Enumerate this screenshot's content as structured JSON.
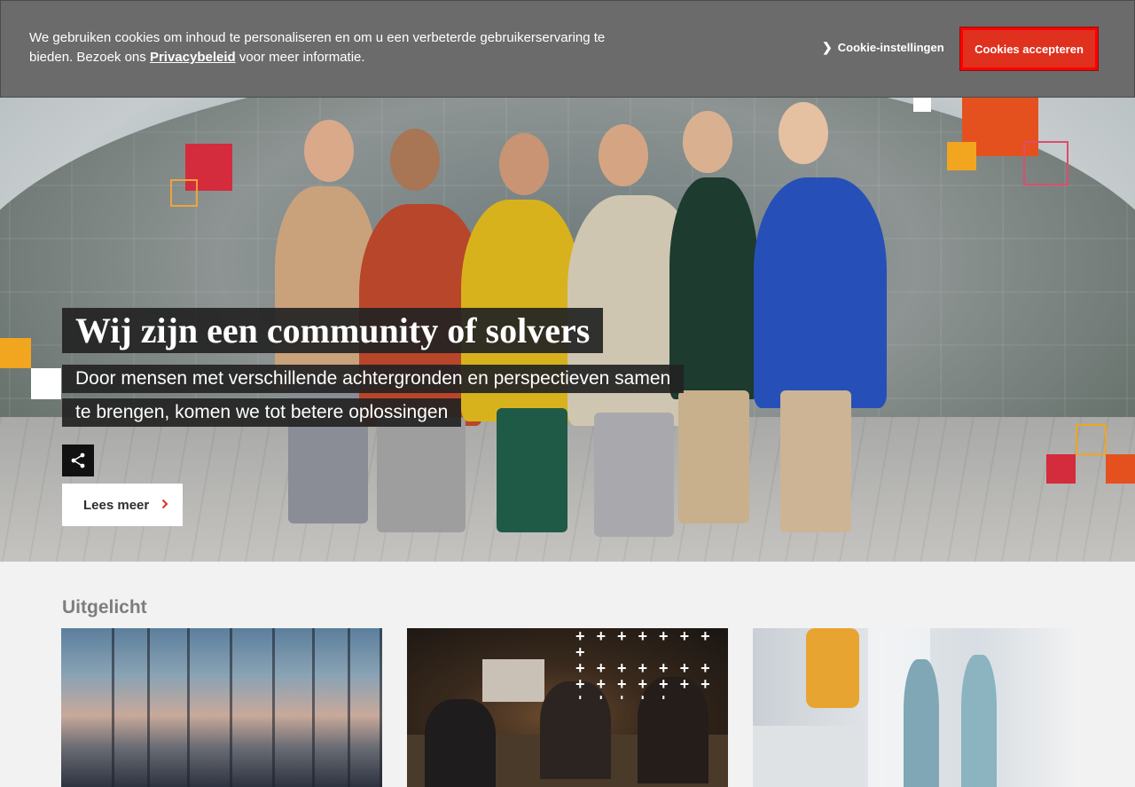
{
  "cookie_banner": {
    "text_before": "We gebruiken cookies om inhoud te personaliseren en om u een verbeterde gebruikerservaring te bieden. Bezoek ons ",
    "privacy_link": "Privacybeleid",
    "text_after": " voor meer informatie.",
    "settings_arrow": "❯",
    "settings_label": "Cookie-instellingen",
    "accept_label": "Cookies accepteren"
  },
  "hero": {
    "title": "Wij zijn een community of solvers",
    "subtitle": "Door mensen met verschillende achtergronden en perspectieven samen te brengen, komen we tot betere oplossingen",
    "read_more_label": "Lees meer",
    "read_more_chevron": "›",
    "share_icon": "share-icon"
  },
  "featured": {
    "title": "Uitgelicht",
    "cards": [
      {
        "image": "glass-tower-skyline-image"
      },
      {
        "image": "video-meeting-team-image"
      },
      {
        "image": "robot-factory-women-image"
      }
    ]
  },
  "colors": {
    "accent": "#e0301e",
    "cookie_bg": "#6b6b6b",
    "caption_bg": "#232323"
  }
}
